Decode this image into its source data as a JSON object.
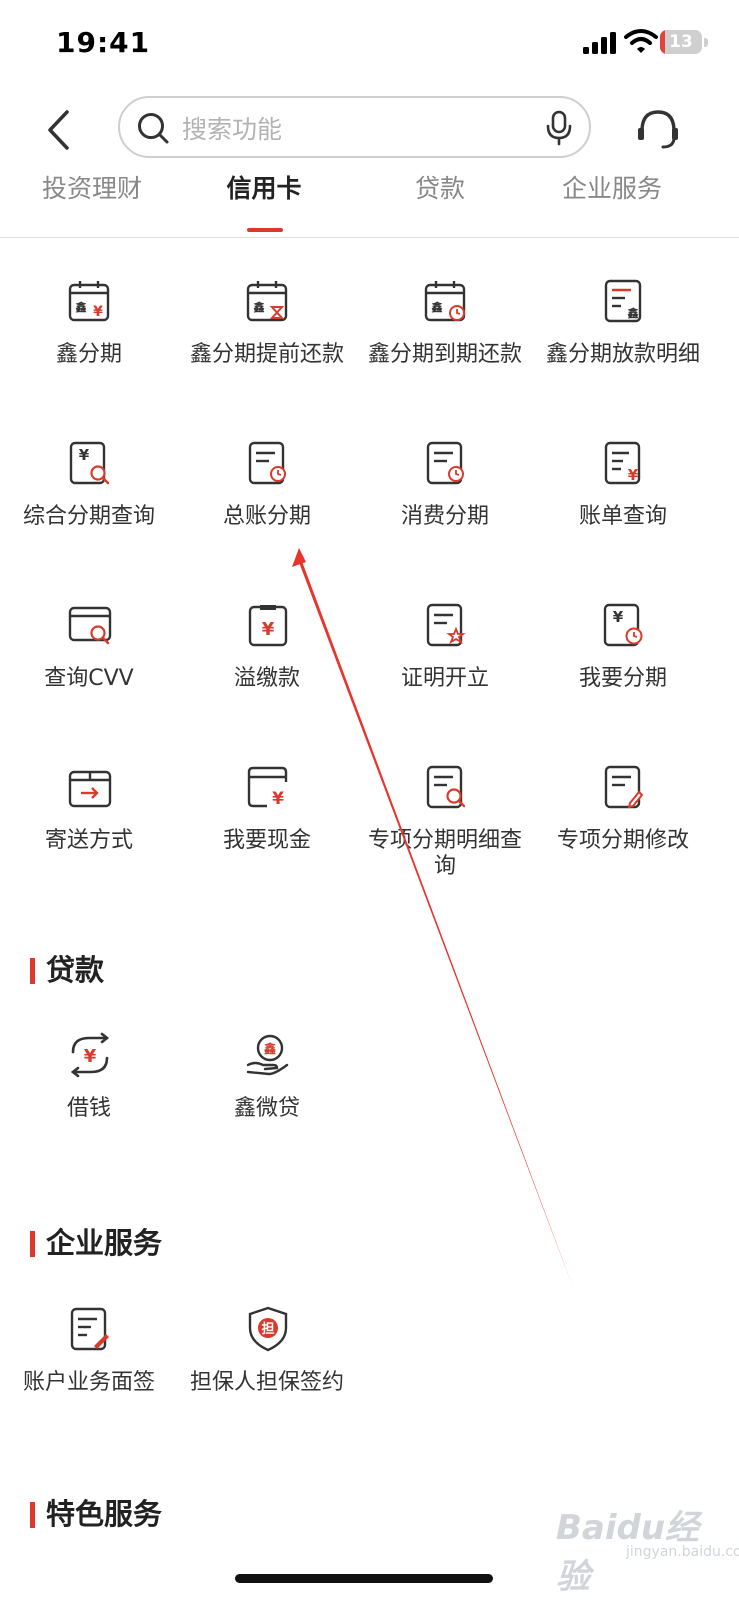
{
  "status_bar": {
    "time": "19:41",
    "battery": "13",
    "battery_level": 0.13
  },
  "search": {
    "placeholder": "搜索功能"
  },
  "tabs": [
    {
      "label": "投资理财"
    },
    {
      "label": "信用卡"
    },
    {
      "label": "贷款"
    },
    {
      "label": "企业服务"
    }
  ],
  "active_tab": "信用卡",
  "credit_card_items": [
    {
      "label": "鑫分期",
      "icon": "calendar-yuan-icon"
    },
    {
      "label": "鑫分期提前还款",
      "icon": "calendar-hourglass-icon"
    },
    {
      "label": "鑫分期到期还款",
      "icon": "calendar-clock-icon"
    },
    {
      "label": "鑫分期放款明细",
      "icon": "document-list-icon"
    },
    {
      "label": "综合分期查询",
      "icon": "receipt-search-icon"
    },
    {
      "label": "总账分期",
      "icon": "document-clock-icon"
    },
    {
      "label": "消费分期",
      "icon": "document-clock-icon"
    },
    {
      "label": "账单查询",
      "icon": "bill-yuan-icon"
    },
    {
      "label": "查询CVV",
      "icon": "card-search-icon"
    },
    {
      "label": "溢缴款",
      "icon": "clipboard-yuan-icon"
    },
    {
      "label": "证明开立",
      "icon": "certificate-star-icon"
    },
    {
      "label": "我要分期",
      "icon": "receipt-clock-icon"
    },
    {
      "label": "寄送方式",
      "icon": "box-arrow-icon"
    },
    {
      "label": "我要现金",
      "icon": "wallet-yuan-icon"
    },
    {
      "label": "专项分期明细查询",
      "icon": "document-search-icon"
    },
    {
      "label": "专项分期修改",
      "icon": "document-edit-icon"
    }
  ],
  "sections": {
    "loan": {
      "title": "贷款",
      "items": [
        {
          "label": "借钱",
          "icon": "exchange-yuan-icon"
        },
        {
          "label": "鑫微贷",
          "icon": "hand-coin-icon"
        }
      ]
    },
    "enterprise": {
      "title": "企业服务",
      "items": [
        {
          "label": "账户业务面签",
          "icon": "document-sign-icon"
        },
        {
          "label": "担保人担保签约",
          "icon": "guarantee-shield-icon"
        }
      ]
    },
    "special": {
      "title": "特色服务"
    }
  },
  "watermark": {
    "main": "Baidu经验",
    "sub": "jingyan.baidu.com"
  },
  "colors": {
    "accent": "#d93a2b",
    "icon_stroke": "#333333",
    "text_muted": "#888888",
    "arrow": "#e8342a"
  }
}
